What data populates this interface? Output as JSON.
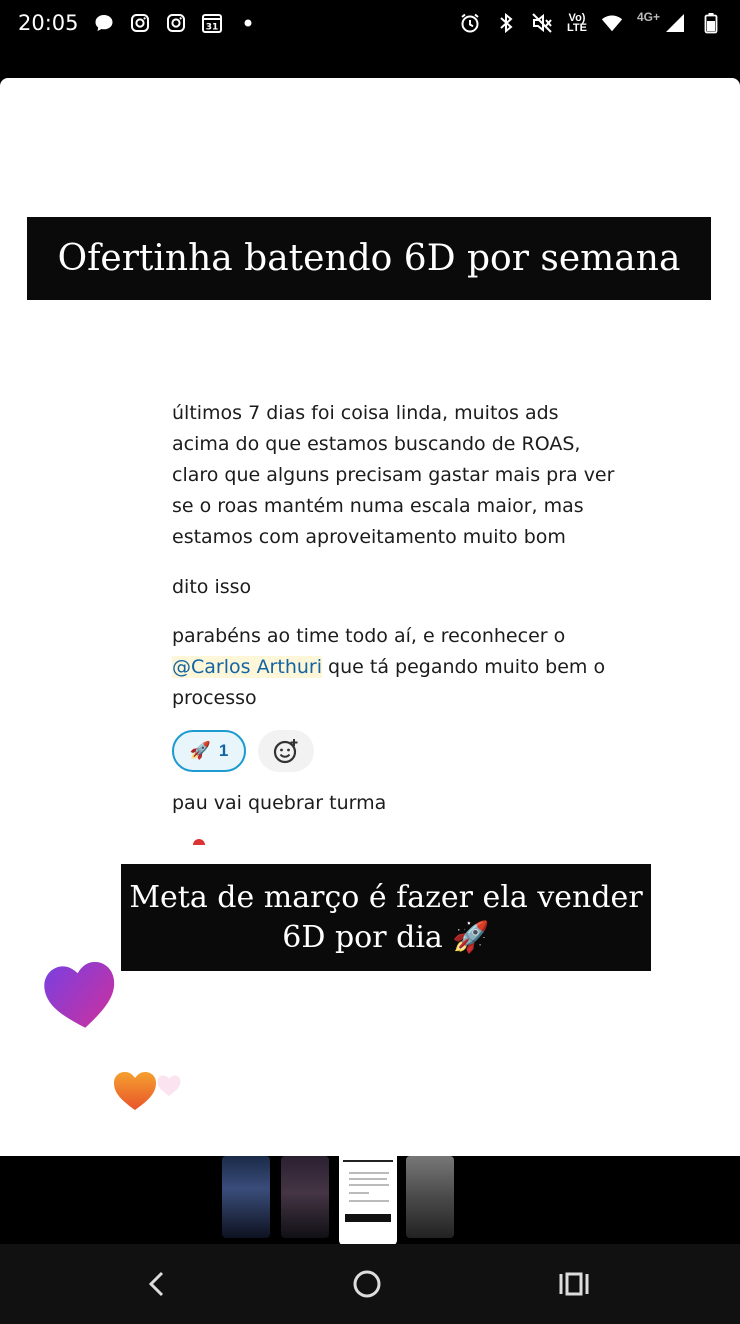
{
  "status_bar": {
    "time": "20:05",
    "left_icons": [
      "chat-bubble-icon",
      "instagram-icon",
      "instagram-icon",
      "calendar-icon",
      "dot-icon"
    ],
    "calendar_day": "31",
    "right_icons": [
      "alarm-icon",
      "bluetooth-icon",
      "mute-icon",
      "volte-icon",
      "wifi-icon",
      "signal-icon",
      "battery-icon"
    ],
    "volte_label_top": "Vo)",
    "volte_label_bottom": "LTE",
    "network_label": "4G+"
  },
  "story": {
    "banner_top": "Ofertinha batendo 6D por semana",
    "message_1": "últimos 7 dias foi coisa linda, muitos ads acima do que estamos buscando de ROAS, claro que alguns precisam gastar mais pra ver se o roas mantém numa escala maior, mas estamos com aproveitamento muito bom",
    "message_2": "dito isso",
    "message_3_before": "parabéns ao time todo aí, e reconhecer o ",
    "message_3_mention": "@Carlos Arthuri",
    "message_3_after": " que tá pegando muito bem o processo",
    "reaction_emoji": "🚀",
    "reaction_count": "1",
    "message_4": "pau vai quebrar turma",
    "banner_bottom_line_1": "Meta de março é fazer ela vender",
    "banner_bottom_line_2": "6D por dia 🚀"
  },
  "colors": {
    "banner_bg": "#0a0a0a",
    "mention": "#1264a3",
    "mention_bg": "#fdf6d8",
    "reaction_border": "#1d9bd1",
    "heart_purple": "#9a3fd8",
    "heart_orange": "#f07a2a"
  },
  "thumbnails": {
    "count": 4,
    "selected_index": 3
  },
  "nav_bar": {
    "icons": [
      "back-icon",
      "home-icon",
      "recents-icon"
    ]
  }
}
